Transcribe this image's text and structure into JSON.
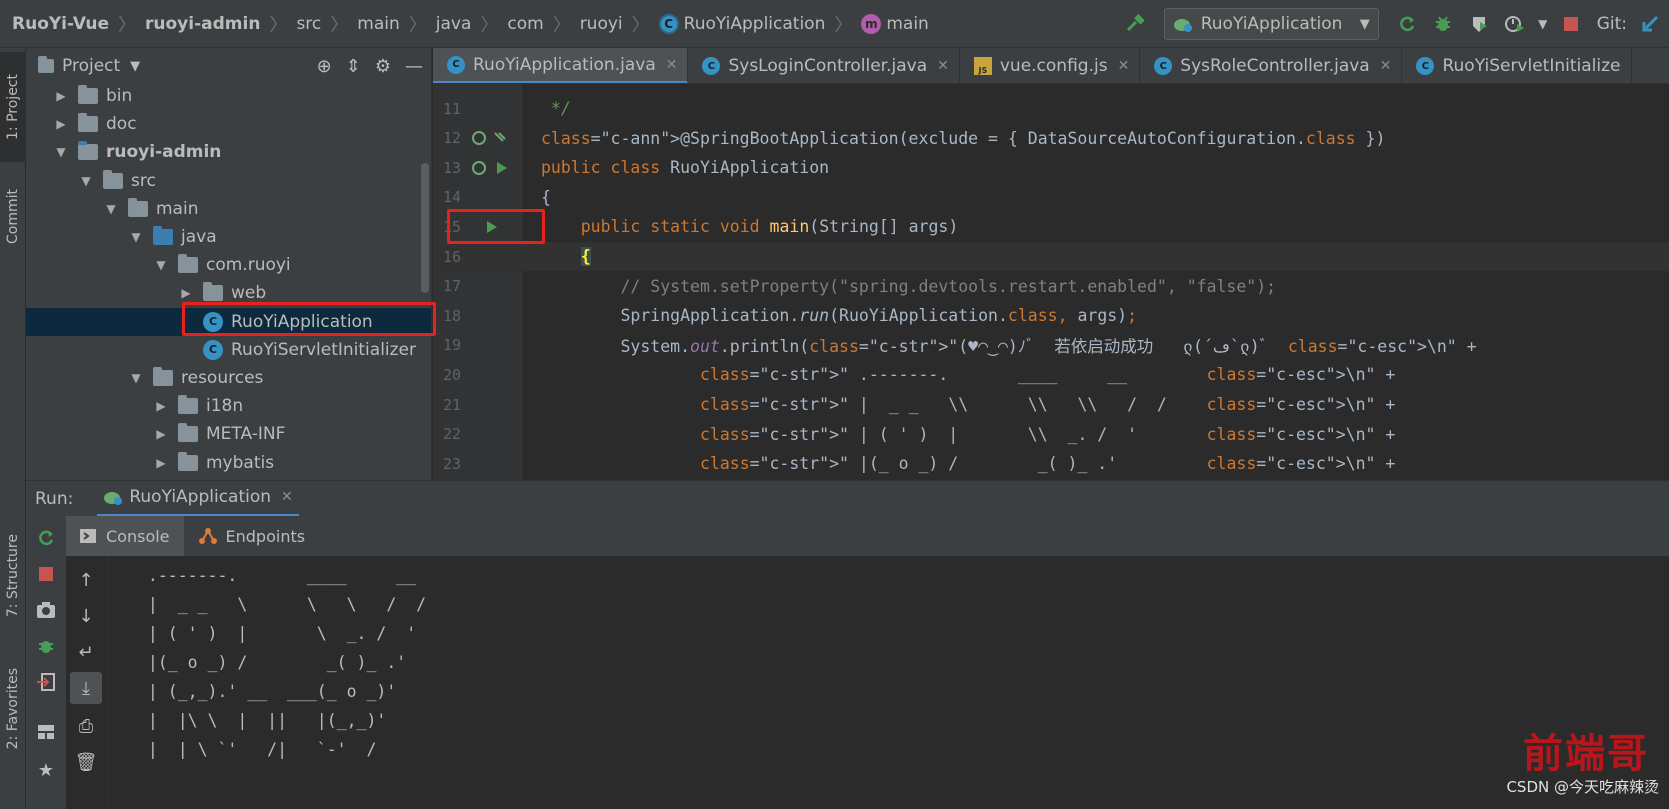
{
  "breadcrumb": {
    "items": [
      "RuoYi-Vue",
      "ruoyi-admin",
      "src",
      "main",
      "java",
      "com",
      "ruoyi",
      "RuoYiApplication",
      "main"
    ]
  },
  "toolbar": {
    "run_config": "RuoYiApplication",
    "git_label": "Git:",
    "icons": [
      "hammer-icon",
      "rerun-icon",
      "debug-icon",
      "coverage-icon",
      "profile-icon",
      "stop-icon",
      "git-update-icon"
    ]
  },
  "left_strip": {
    "project_tab": "1: Project",
    "commit_tab": "Commit",
    "structure_tab": "7: Structure",
    "favorites_tab": "2: Favorites"
  },
  "project_panel": {
    "title": "Project",
    "tree": [
      {
        "label": "bin",
        "depth": 1,
        "expanded": false,
        "type": "folder",
        "bold": false
      },
      {
        "label": "doc",
        "depth": 1,
        "expanded": false,
        "type": "folder",
        "bold": false
      },
      {
        "label": "ruoyi-admin",
        "depth": 1,
        "expanded": true,
        "type": "module",
        "bold": true
      },
      {
        "label": "src",
        "depth": 2,
        "expanded": true,
        "type": "folder",
        "bold": false
      },
      {
        "label": "main",
        "depth": 3,
        "expanded": true,
        "type": "folder",
        "bold": false
      },
      {
        "label": "java",
        "depth": 4,
        "expanded": true,
        "type": "source",
        "bold": false
      },
      {
        "label": "com.ruoyi",
        "depth": 5,
        "expanded": true,
        "type": "package",
        "bold": false
      },
      {
        "label": "web",
        "depth": 6,
        "expanded": false,
        "type": "package",
        "bold": false
      },
      {
        "label": "RuoYiApplication",
        "depth": 6,
        "expanded": null,
        "type": "spring-class",
        "bold": false,
        "selected": true
      },
      {
        "label": "RuoYiServletInitializer",
        "depth": 6,
        "expanded": null,
        "type": "class",
        "bold": false
      },
      {
        "label": "resources",
        "depth": 4,
        "expanded": true,
        "type": "resources",
        "bold": false
      },
      {
        "label": "i18n",
        "depth": 5,
        "expanded": false,
        "type": "folder",
        "bold": false
      },
      {
        "label": "META-INF",
        "depth": 5,
        "expanded": false,
        "type": "folder",
        "bold": false
      },
      {
        "label": "mybatis",
        "depth": 5,
        "expanded": false,
        "type": "folder",
        "bold": false
      }
    ]
  },
  "editor_tabs": [
    {
      "label": "RuoYiApplication.java",
      "icon": "spring-class",
      "active": true
    },
    {
      "label": "SysLoginController.java",
      "icon": "class",
      "active": false
    },
    {
      "label": "vue.config.js",
      "icon": "js",
      "active": false
    },
    {
      "label": "SysRoleController.java",
      "icon": "class",
      "active": false
    },
    {
      "label": "RuoYiServletInitialize",
      "icon": "class",
      "active": false
    }
  ],
  "editor": {
    "lines": [
      {
        "num": "11",
        "text": " */"
      },
      {
        "num": "12",
        "text": "@SpringBootApplication(exclude = { DataSourceAutoConfiguration.class })"
      },
      {
        "num": "13",
        "text": "public class RuoYiApplication"
      },
      {
        "num": "14",
        "text": "{"
      },
      {
        "num": "15",
        "text": "    public static void main(String[] args)"
      },
      {
        "num": "16",
        "text": "    {"
      },
      {
        "num": "17",
        "text": "        // System.setProperty(\"spring.devtools.restart.enabled\", \"false\");"
      },
      {
        "num": "18",
        "text": "        SpringApplication.run(RuoYiApplication.class, args);"
      },
      {
        "num": "19",
        "text": "        System.out.println(\"(♥◠‿◠)ﾉﾞ  若依启动成功   ლ(´ڡ`ლ)ﾞ  \\n\" +"
      },
      {
        "num": "20",
        "text": "                \" .-------.       ____     __        \\n\" +"
      },
      {
        "num": "21",
        "text": "                \" |  _ _   \\\\      \\\\   \\\\   /  /    \\n\" +"
      },
      {
        "num": "22",
        "text": "                \" | ( ' )  |       \\\\  _. /  '       \\n\" +"
      },
      {
        "num": "23",
        "text": "                \" |(_ o _) /        _( )_ .'         \\n\" +"
      }
    ]
  },
  "run_window": {
    "label": "Run:",
    "tab": "RuoYiApplication",
    "console_tab": "Console",
    "endpoints_tab": "Endpoints",
    "output": [
      " .-------.       ____     __",
      " |  _ _   \\      \\   \\   /  /",
      " | ( ' )  |       \\  _. /  '",
      " |(_ o _) /        _( )_ .'",
      " | (_,_).' __  ___(_ o _)'",
      " |  |\\ \\  |  ||   |(_,_)'",
      " |  | \\ `'   /|   `-'  /"
    ]
  },
  "watermark": {
    "text": "CSDN @今天吃麻辣烫",
    "logo": "前端哥"
  }
}
